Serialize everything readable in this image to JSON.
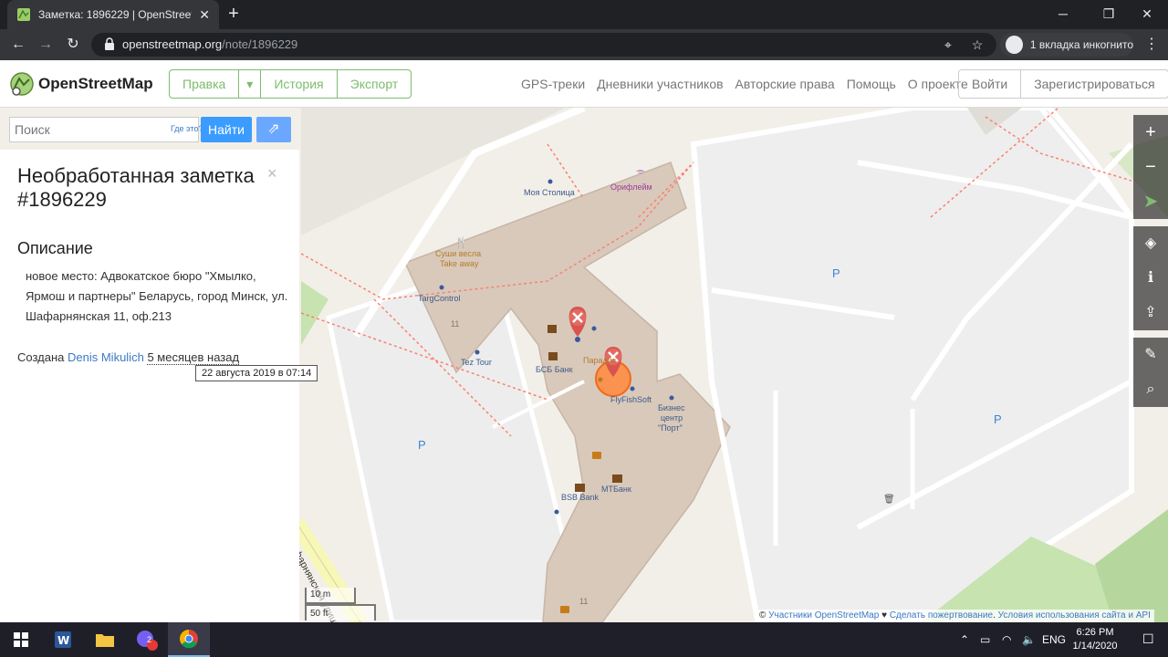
{
  "browser": {
    "tab_title": "Заметка: 1896229 | OpenStreetM",
    "url_domain": "openstreetmap.org",
    "url_path": "/note/1896229",
    "incognito_label": "1 вкладка инкогнито"
  },
  "header": {
    "brand": "OpenStreetMap",
    "edit_label": "Правка",
    "history_label": "История",
    "export_label": "Экспорт",
    "nav": [
      "GPS-треки",
      "Дневники участников",
      "Авторские права",
      "Помощь",
      "О проекте"
    ],
    "login_label": "Войти",
    "signup_label": "Зарегистрироваться"
  },
  "search": {
    "placeholder": "Поиск",
    "where_label": "Где это?",
    "go_label": "Найти"
  },
  "note": {
    "title": "Необработанная заметка #1896229",
    "close_symbol": "×",
    "description_heading": "Описание",
    "description": "новое место: Адвокатское бюро \"Хмылко, Ярмош и партнеры\" Беларусь, город Минск, ул. Шафарнянская 11, оф.213",
    "created_prefix": "Создана",
    "author": "Denis Mikulich",
    "created_ago": "5 месяцев назад",
    "created_tooltip": "22 августа 2019 в 07:14"
  },
  "map": {
    "labels": {
      "moya_stolitsa": "Моя Столица",
      "oriflame": "Орифлейм",
      "sushi_line1": "Суши весла",
      "sushi_line2": "Take away",
      "targcontrol": "TargControl",
      "num11_a": "11",
      "tez_tour": "Tez Tour",
      "bsb_bank_ru": "БСБ Банк",
      "paradis": "Паради́с",
      "flyfishsoft": "FlyFishSoft",
      "bc_line1": "Бизнес",
      "bc_line2": "центр",
      "bc_line3": "\"Порт\"",
      "mtbank": "МТБанк",
      "bsb_bank_en": "BSB Bank",
      "num11_b": "11",
      "street": "Шафарнянская улица",
      "parking": "P"
    },
    "scale_m": "10 m",
    "scale_ft": "50 ft",
    "attribution": {
      "prefix": "©",
      "contributors": "Участники OpenStreetMap",
      "heart": "♥",
      "donate": "Сделать пожертвование",
      "terms": "Условия использования сайта и API"
    },
    "controls": [
      "zoom-in",
      "zoom-out",
      "locate",
      "layers",
      "info",
      "share",
      "add-note",
      "query"
    ],
    "colors": {
      "land": "#f2efe9",
      "building": "#d9c9ba",
      "note_marker": "#d9534f",
      "highlight": "#ff8a3c",
      "grass": "#c6e3b0"
    }
  },
  "taskbar": {
    "lang": "ENG",
    "time": "6:26 PM",
    "date": "1/14/2020",
    "viber_badge": "2"
  }
}
